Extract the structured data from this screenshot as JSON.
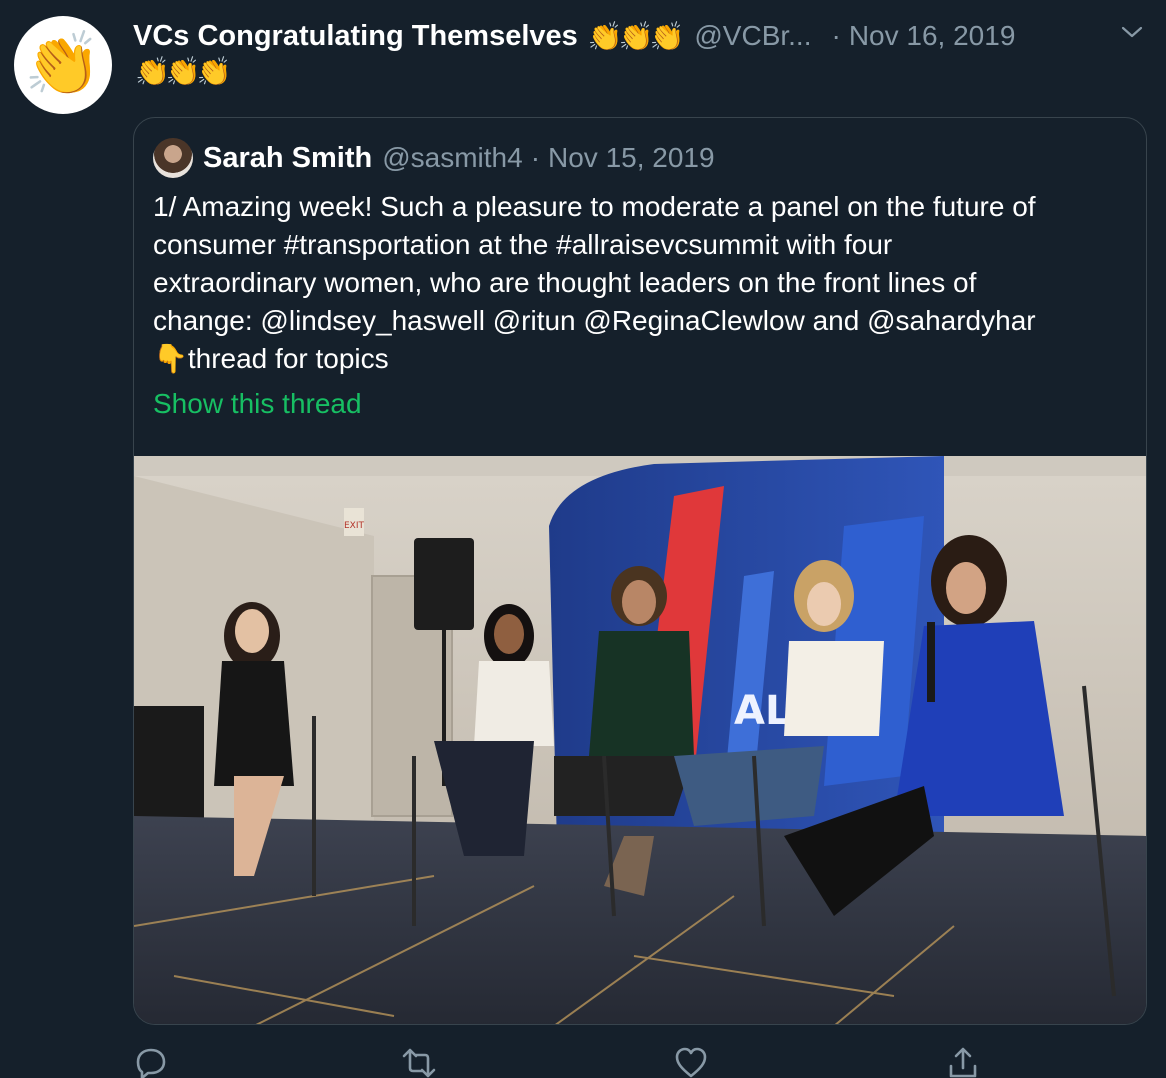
{
  "tweet": {
    "avatar_emoji": "👏",
    "display_name": "VCs Congratulating Themselves",
    "name_emoji_line1": "👏👏👏",
    "name_emoji_line2": "👏👏👏",
    "handle": "@VCBr...",
    "separator": "·",
    "date": "Nov 16, 2019",
    "menu_icon": "chevron-down-icon"
  },
  "quoted_tweet": {
    "avatar_icon": "profile-photo",
    "display_name": "Sarah Smith",
    "handle": "@sasmith4",
    "separator": "·",
    "date": "Nov 15, 2019",
    "text_lines": [
      "1/ Amazing week! Such a pleasure to moderate a panel on the future of",
      "consumer #transportation at the #allraisevcsummit with four",
      "extraordinary women, who are thought leaders on the front lines of",
      "change: @lindsey_haswell @ritun @ReginaClewlow and @sahardyhar",
      "👇thread for topics"
    ],
    "show_thread": "Show this thread",
    "photo_sign_text": "AL    SE",
    "exit_sign": "EXIT"
  },
  "actions": [
    {
      "name": "reply",
      "icon": "reply-icon"
    },
    {
      "name": "retweet",
      "icon": "retweet-icon"
    },
    {
      "name": "like",
      "icon": "heart-icon"
    },
    {
      "name": "share",
      "icon": "share-icon"
    }
  ],
  "colors": {
    "background": "#15202b",
    "border": "#38444d",
    "muted": "#8899a6",
    "link_green": "#17bf63",
    "text": "#ffffff"
  }
}
